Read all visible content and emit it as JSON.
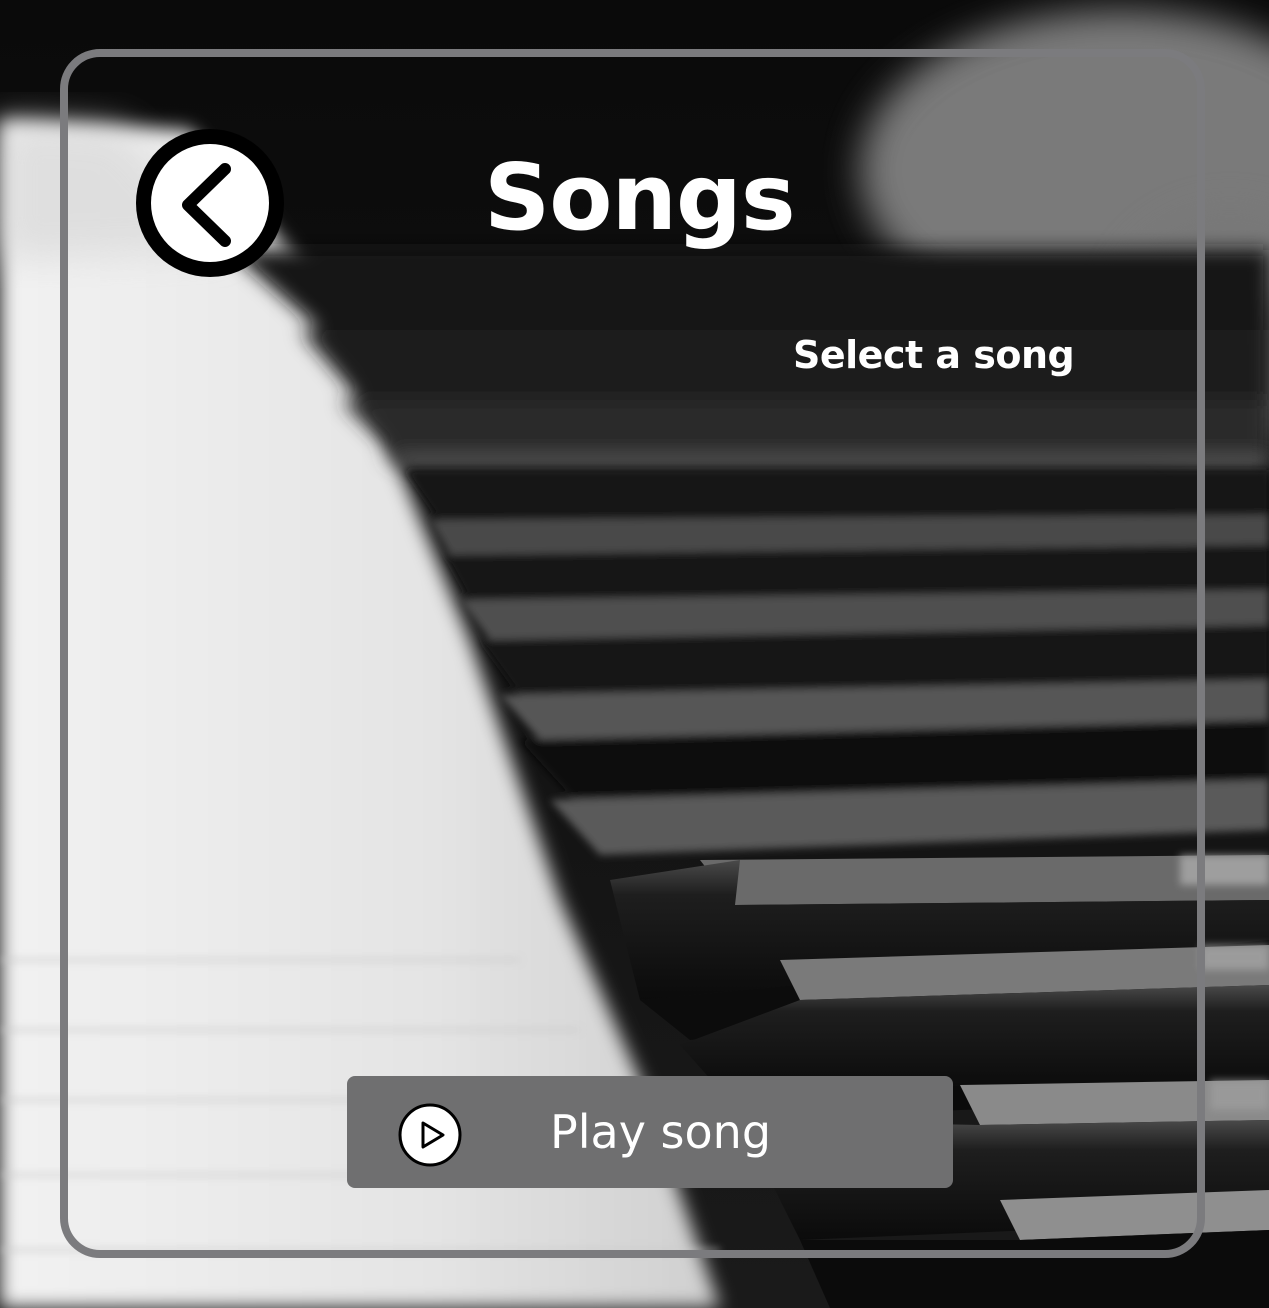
{
  "screen": {
    "title": "Songs",
    "subtitle": "Select a song"
  },
  "back_button": {
    "icon": "chevron-left-icon"
  },
  "play_button": {
    "label": "Play song",
    "icon": "play-icon"
  },
  "colors": {
    "frame": "#7b7b7e",
    "play_button_bg": "#6f6f70",
    "text": "#ffffff"
  }
}
